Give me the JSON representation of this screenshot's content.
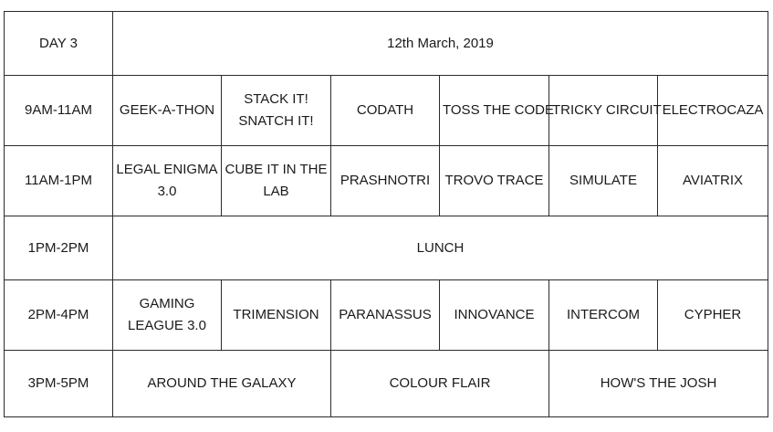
{
  "header": {
    "day": "DAY 3",
    "date": "12th March, 2019"
  },
  "rows": [
    {
      "time": "9AM-11AM",
      "events": [
        "GEEK-A-THON",
        "STACK IT! SNATCH IT!",
        "CODATH",
        "TOSS THE CODE",
        "TRICKY CIRCUIT",
        "ELECTROCAZA"
      ]
    },
    {
      "time": "11AM-1PM",
      "events": [
        "LEGAL ENIGMA 3.0",
        "CUBE IT IN THE LAB",
        "PRASHNOTRI",
        "TROVO TRACE",
        "SIMULATE",
        "AVIATRIX"
      ]
    },
    {
      "time": "1PM-2PM",
      "events": [
        "LUNCH"
      ]
    },
    {
      "time": "2PM-4PM",
      "events": [
        "GAMING LEAGUE 3.0",
        "TRIMENSION",
        "PARANASSUS",
        "INNOVANCE",
        "INTERCOM",
        "CYPHER"
      ]
    },
    {
      "time": "3PM-5PM",
      "events": [
        "AROUND THE GALAXY",
        "COLOUR FLAIR",
        "HOW'S THE JOSH"
      ]
    }
  ]
}
